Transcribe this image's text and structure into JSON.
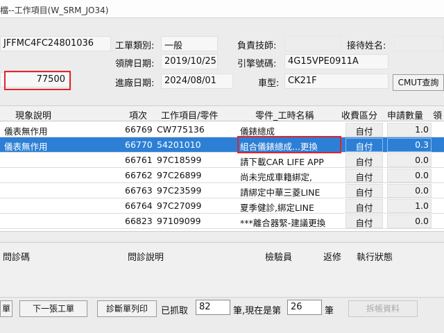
{
  "window": {
    "title": "檔--工作項目(W_SRM_JO34)"
  },
  "form": {
    "code": {
      "value": "JFFMC4FC24801036"
    },
    "mileage": {
      "value": "77500"
    },
    "work_type": {
      "label": "工單類別:",
      "value": "一般"
    },
    "technician": {
      "label": "負責技師:",
      "value": ""
    },
    "receptionist": {
      "label": "接待姓名:",
      "value": ""
    },
    "plate_date": {
      "label": "領牌日期:",
      "value": "2019/10/25"
    },
    "engine_no": {
      "label": "引擎號碼:",
      "value": "4G15VPE0911A"
    },
    "entry_date": {
      "label": "進廠日期:",
      "value": "2024/08/01"
    },
    "model": {
      "label": "車型:",
      "value": "CK21F"
    },
    "cmut_button": "CMUT查詢"
  },
  "grid": {
    "headers": {
      "symptom": "現象說明",
      "item_no": "項次",
      "part_no": "工作項目/零件",
      "name": "零件_工時名稱",
      "charge": "收費區分",
      "qty": "申請數量",
      "extra": "領"
    },
    "rows": [
      {
        "symptom": "儀表無作用",
        "item_no": "66769",
        "part_no": "CW775136",
        "name": "儀錶總成",
        "charge": "自付",
        "qty": "1.0"
      },
      {
        "symptom": "儀表無作用",
        "item_no": "66770",
        "part_no": "54201010",
        "name": "組合儀錶總成...更換",
        "charge": "自付",
        "qty": "0.3"
      },
      {
        "symptom": "",
        "item_no": "66761",
        "part_no": "97C18599",
        "name": "請下載CAR LIFE APP",
        "charge": "自付",
        "qty": "0.0"
      },
      {
        "symptom": "",
        "item_no": "66762",
        "part_no": "97C26899",
        "name": "尚未完成車籍綁定,",
        "charge": "自付",
        "qty": "0.0"
      },
      {
        "symptom": "",
        "item_no": "66763",
        "part_no": "97C23599",
        "name": "請綁定中華三菱LINE",
        "charge": "自付",
        "qty": "0.0"
      },
      {
        "symptom": "",
        "item_no": "66764",
        "part_no": "97C27099",
        "name": "夏季健診,綁定LINE",
        "charge": "自付",
        "qty": "1.0"
      },
      {
        "symptom": "",
        "item_no": "66823",
        "part_no": "97109099",
        "name": "***離合器緊-建議更換",
        "charge": "自付",
        "qty": "0.0"
      }
    ]
  },
  "lower": {
    "headers": {
      "code": "問診碼",
      "desc": "問診說明",
      "inspector": "檢驗員",
      "rework": "返修",
      "status": "執行狀態"
    }
  },
  "footer": {
    "prev_button": "單",
    "next_button": "下一張工單",
    "print_button": "診斷單列印",
    "fetched_label": "已抓取",
    "fetched_value": "82",
    "current_label": "筆,現在是第",
    "current_value": "26",
    "suffix_label": "筆",
    "split_button": "拆帳資料"
  },
  "colors": {
    "selection": "#2d7fd6",
    "highlight_box": "#e0242d"
  }
}
